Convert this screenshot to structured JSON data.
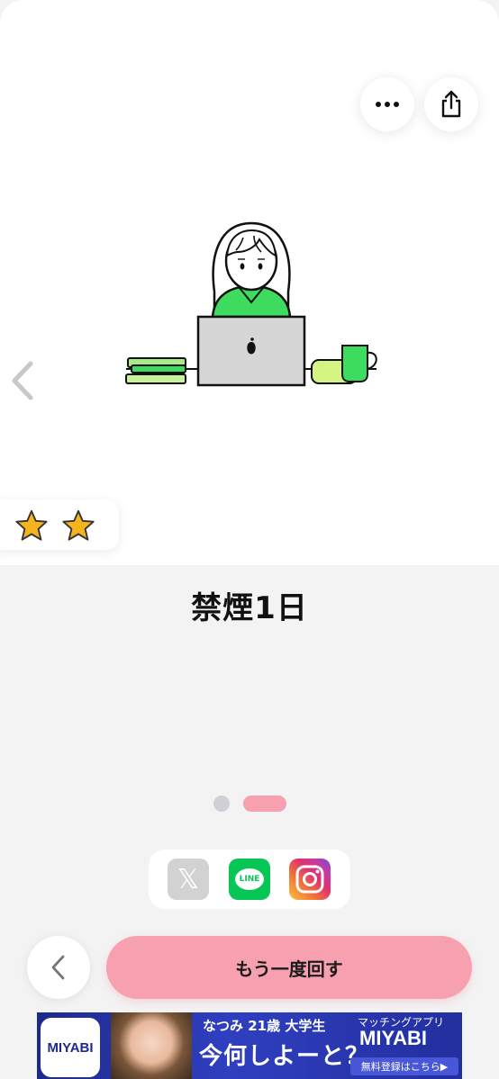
{
  "result": {
    "title": "禁煙1日",
    "rating_stars": 2
  },
  "icons": {
    "more": "more-horizontal-icon",
    "share": "share-icon",
    "prev": "chevron-left-icon",
    "star": "star-icon",
    "x": "x-logo-icon",
    "line": "line-logo-icon",
    "instagram": "instagram-logo-icon",
    "back": "chevron-left-icon"
  },
  "pagination": {
    "total": 2,
    "active": 2
  },
  "share": {
    "line_label": "LINE"
  },
  "actions": {
    "retry_label": "もう一度回す"
  },
  "ad": {
    "logo": "MIYABI",
    "subtitle": "なつみ 21歳 大学生",
    "headline": "今何しよーと？",
    "tagline": "マッチングアプリ",
    "brand": "MIYABI",
    "cta": "無料登録はこちら▶"
  },
  "colors": {
    "accent_pink": "#f6a0b0",
    "illustration_green": "#3ddb5e",
    "star_gold": "#f5b31d",
    "line_green": "#06c755"
  }
}
